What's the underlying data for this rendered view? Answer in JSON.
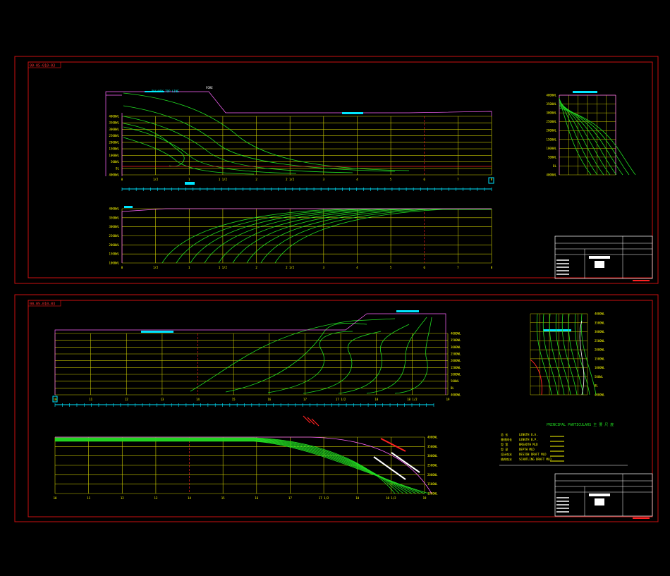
{
  "sheets": [
    {
      "tag": "00-05-010-03",
      "stations": [
        "0",
        "1/2",
        "1",
        "1 1/2",
        "2",
        "2 1/2",
        "3",
        "4",
        "5",
        "6",
        "7",
        "8",
        "9",
        "10"
      ],
      "waterlines": [
        "4000WL",
        "3500WL",
        "3000WL",
        "2500WL",
        "2000WL",
        "1500WL",
        "1000WL",
        "500WL",
        "BL"
      ],
      "labels": [
        "BULWARK TOP LINE",
        "FORE",
        "DECK",
        "CL"
      ]
    },
    {
      "tag": "00-05-010-03",
      "stations": [
        "10",
        "11",
        "12",
        "13",
        "14",
        "15",
        "16",
        "17",
        "17 1/2",
        "18",
        "18 1/2",
        "19",
        "19 1/2",
        "20"
      ],
      "waterlines": [
        "4000WL",
        "3500WL",
        "3000WL",
        "2500WL",
        "2000WL",
        "1500WL",
        "1000WL",
        "500WL",
        "BL"
      ],
      "labels": [
        "BULWARK TOP LINE",
        "AFT",
        "DECK",
        "CL"
      ]
    }
  ],
  "particulars": {
    "title": "PRINCIPAL PARTICULARS 主 要 尺 度",
    "rows": [
      {
        "k": "总 长",
        "v": "LENGTH O.A."
      },
      {
        "k": "垂线间长",
        "v": "LENGTH B.P."
      },
      {
        "k": "型 宽",
        "v": "BREADTH MLD"
      },
      {
        "k": "型 深",
        "v": "DEPTH MLD"
      },
      {
        "k": "设计吃水",
        "v": "DESIGN DRAFT MLD"
      },
      {
        "k": "结构吃水",
        "v": "SCANTLING DRAFT MLD"
      }
    ]
  },
  "colors": {
    "frame": "#cc1111",
    "grid": "#c8c800",
    "curve": "#22dd22",
    "pink": "#ff66ff",
    "cyan": "#00e5ff"
  }
}
